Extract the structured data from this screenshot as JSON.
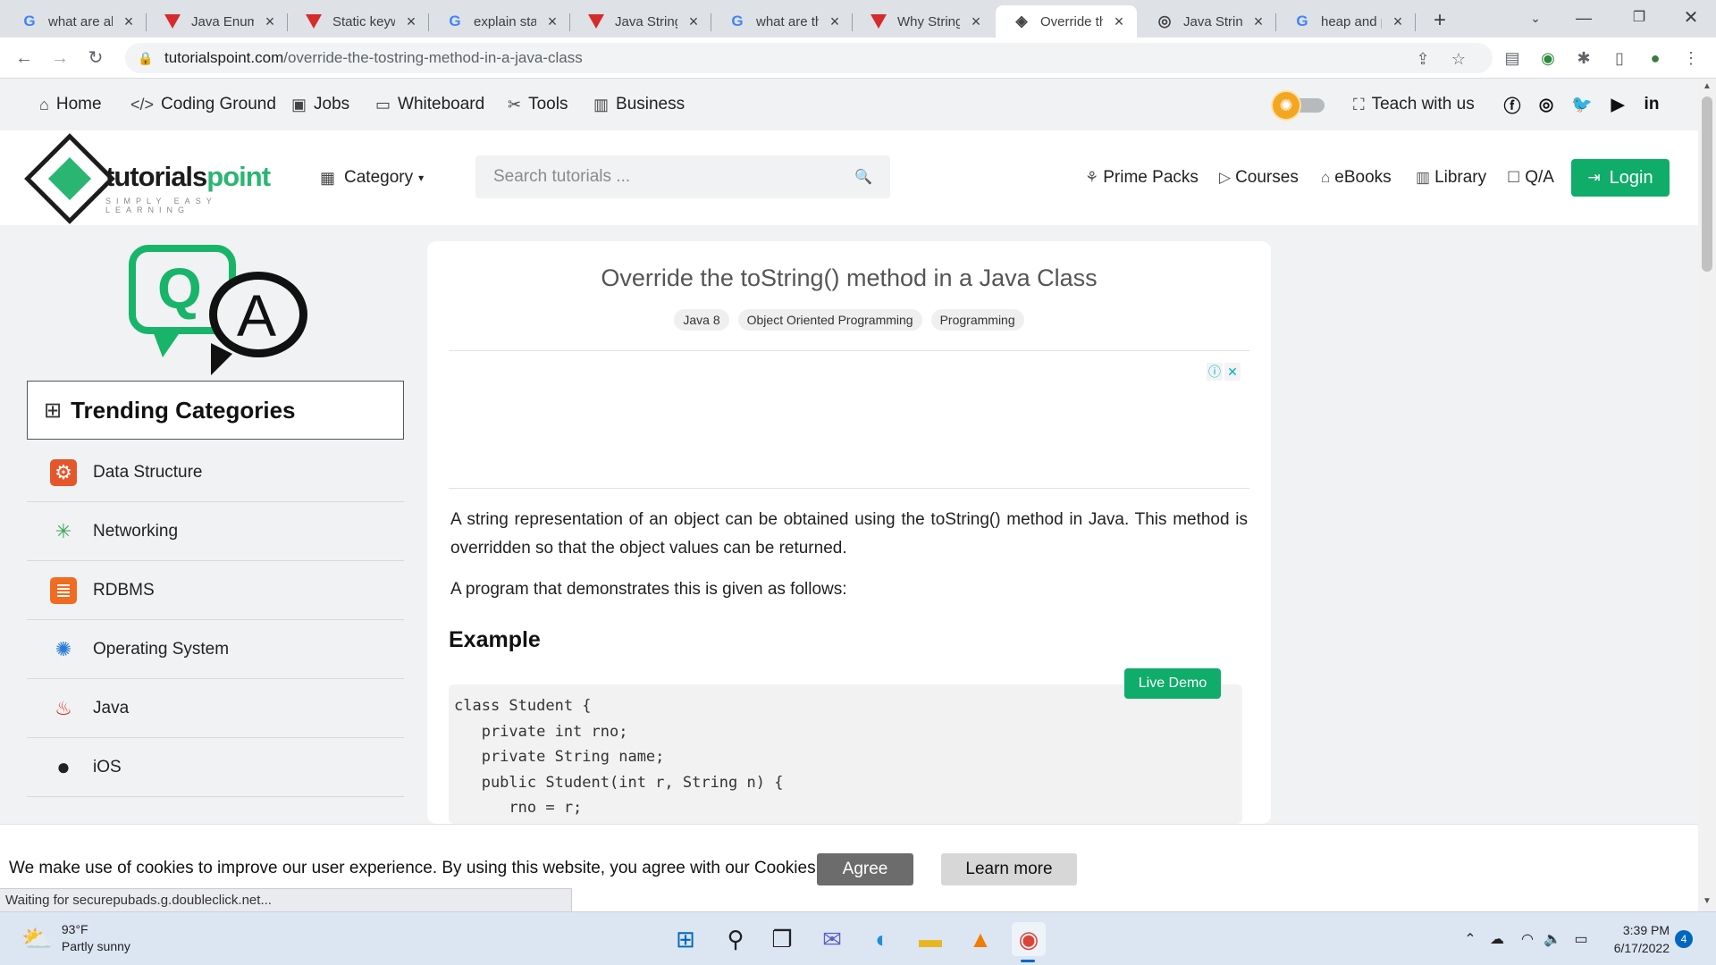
{
  "browser": {
    "tabs": [
      {
        "title": "what are all",
        "favicon": "google-icon"
      },
      {
        "title": "Java Enum",
        "favicon": "red-triangle-icon"
      },
      {
        "title": "Static keyw",
        "favicon": "red-triangle-icon"
      },
      {
        "title": "explain stat",
        "favicon": "google-icon"
      },
      {
        "title": "Java String",
        "favicon": "red-triangle-icon"
      },
      {
        "title": "what are th",
        "favicon": "google-icon"
      },
      {
        "title": "Why String",
        "favicon": "red-triangle-icon"
      },
      {
        "title": "Override th",
        "favicon": "tutorialspoint-icon",
        "active": true
      },
      {
        "title": "Java String",
        "favicon": "tutorialspoint-icon"
      },
      {
        "title": "heap and p",
        "favicon": "google-icon"
      }
    ],
    "url_host": "tutorialspoint.com",
    "url_path": "/override-the-tostring-method-in-a-java-class",
    "status_text": "Waiting for securepubads.g.doubleclick.net..."
  },
  "site_nav": {
    "items": [
      "Home",
      "Coding Ground",
      "Jobs",
      "Whiteboard",
      "Tools",
      "Business"
    ],
    "teach": "Teach with us"
  },
  "header": {
    "logo_text_a": "tutorials",
    "logo_text_b": "point",
    "logo_tagline": "SIMPLY EASY LEARNING",
    "category": "Category",
    "search_placeholder": "Search tutorials ...",
    "links": [
      "Prime Packs",
      "Courses",
      "eBooks",
      "Library",
      "Q/A"
    ],
    "login": "Login"
  },
  "sidebar": {
    "qa_q": "Q",
    "qa_a": "A",
    "heading": "Trending Categories",
    "categories": [
      {
        "label": "Data Structure",
        "icon": "data-structure-icon"
      },
      {
        "label": "Networking",
        "icon": "networking-icon"
      },
      {
        "label": "RDBMS",
        "icon": "rdbms-icon"
      },
      {
        "label": "Operating System",
        "icon": "operating-system-icon"
      },
      {
        "label": "Java",
        "icon": "java-icon"
      },
      {
        "label": "iOS",
        "icon": "apple-icon"
      }
    ]
  },
  "article": {
    "title": "Override the toString() method in a Java Class",
    "tags": [
      "Java 8",
      "Object Oriented Programming",
      "Programming"
    ],
    "para1": "A string representation of an object can be obtained using the toString() method in Java. This method is overridden so that the object values can be returned.",
    "para2": "A program that demonstrates this is given as follows:",
    "example_heading": "Example",
    "live_demo": "Live Demo",
    "code_lines": [
      "class Student {",
      "   private int rno;",
      "   private String name;",
      "   public Student(int r, String n) {",
      "      rno = r;"
    ]
  },
  "cookie": {
    "text": "We make use of cookies to improve our user experience. By using this website, you agree with our Cookies Policy.",
    "agree": "Agree",
    "learn": "Learn more"
  },
  "taskbar": {
    "temp": "93°F",
    "weather": "Partly sunny",
    "time": "3:39 PM",
    "date": "6/17/2022",
    "notifications": "4"
  }
}
